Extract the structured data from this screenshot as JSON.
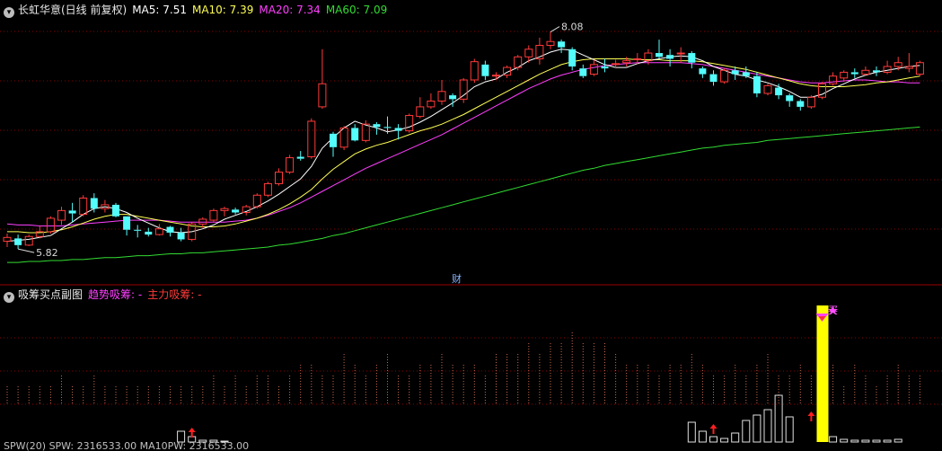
{
  "header": {
    "title": "长虹华意(日线 前复权)",
    "ma5": "MA5: 7.51",
    "ma10": "MA10: 7.39",
    "ma20": "MA20: 7.34",
    "ma60": "MA60: 7.09"
  },
  "sub_header": {
    "title": "吸筹买点副图",
    "trend_label": "趋势吸筹: -",
    "main_label": "主力吸筹: -"
  },
  "bottom_text": "SPW(20) SPW: 2316533.00  MA10PW: 2316533.00",
  "colors": {
    "up": "#ff3a3a",
    "down": "#54fcfc",
    "ma5": "#ffffff",
    "ma10": "#ffff55",
    "ma20": "#ff3fff",
    "ma60": "#32dc32",
    "grid": "#8a0000",
    "highlight": "#ffff00"
  },
  "chart_data": [
    {
      "type": "candlestick",
      "name": "长虹华意(日线 前复权)",
      "annotations": {
        "high": "8.08",
        "low": "5.82",
        "finance_marker": "财"
      },
      "ohlc": [
        [
          5.9,
          5.98,
          5.84,
          5.94
        ],
        [
          5.93,
          5.97,
          5.82,
          5.86
        ],
        [
          5.86,
          5.97,
          5.85,
          5.95
        ],
        [
          5.95,
          6.06,
          5.93,
          6.0
        ],
        [
          6.0,
          6.16,
          5.98,
          6.14
        ],
        [
          6.12,
          6.26,
          6.07,
          6.22
        ],
        [
          6.22,
          6.3,
          6.1,
          6.19
        ],
        [
          6.18,
          6.38,
          6.16,
          6.35
        ],
        [
          6.35,
          6.4,
          6.2,
          6.24
        ],
        [
          6.24,
          6.33,
          6.2,
          6.28
        ],
        [
          6.28,
          6.3,
          6.15,
          6.16
        ],
        [
          6.16,
          6.16,
          5.96,
          6.02
        ],
        [
          6.02,
          6.07,
          5.94,
          6.01
        ],
        [
          6.0,
          6.04,
          5.95,
          5.97
        ],
        [
          5.97,
          6.08,
          5.96,
          6.03
        ],
        [
          6.05,
          6.06,
          5.95,
          5.99
        ],
        [
          5.99,
          6.04,
          5.9,
          5.92
        ],
        [
          5.92,
          6.1,
          5.9,
          6.08
        ],
        [
          6.08,
          6.15,
          6.04,
          6.13
        ],
        [
          6.12,
          6.24,
          6.1,
          6.22
        ],
        [
          6.22,
          6.26,
          6.16,
          6.24
        ],
        [
          6.23,
          6.25,
          6.18,
          6.2
        ],
        [
          6.2,
          6.28,
          6.17,
          6.26
        ],
        [
          6.26,
          6.4,
          6.24,
          6.38
        ],
        [
          6.38,
          6.52,
          6.36,
          6.5
        ],
        [
          6.5,
          6.66,
          6.48,
          6.62
        ],
        [
          6.62,
          6.8,
          6.6,
          6.77
        ],
        [
          6.78,
          6.84,
          6.74,
          6.76
        ],
        [
          6.78,
          7.18,
          6.76,
          7.15
        ],
        [
          7.3,
          7.9,
          7.28,
          7.54
        ],
        [
          7.02,
          7.04,
          6.78,
          6.88
        ],
        [
          6.88,
          7.1,
          6.85,
          7.08
        ],
        [
          7.08,
          7.12,
          6.94,
          6.95
        ],
        [
          6.95,
          7.16,
          6.93,
          7.12
        ],
        [
          7.12,
          7.14,
          7.01,
          7.09
        ],
        [
          7.09,
          7.2,
          7.02,
          7.08
        ],
        [
          7.08,
          7.12,
          6.96,
          7.05
        ],
        [
          7.05,
          7.23,
          7.03,
          7.21
        ],
        [
          7.2,
          7.4,
          7.18,
          7.3
        ],
        [
          7.3,
          7.44,
          7.28,
          7.36
        ],
        [
          7.36,
          7.58,
          7.32,
          7.46
        ],
        [
          7.42,
          7.44,
          7.3,
          7.38
        ],
        [
          7.38,
          7.6,
          7.34,
          7.58
        ],
        [
          7.58,
          7.8,
          7.55,
          7.77
        ],
        [
          7.74,
          7.78,
          7.58,
          7.62
        ],
        [
          7.62,
          7.66,
          7.58,
          7.63
        ],
        [
          7.63,
          7.73,
          7.6,
          7.71
        ],
        [
          7.71,
          7.84,
          7.68,
          7.82
        ],
        [
          7.82,
          7.94,
          7.76,
          7.9
        ],
        [
          7.8,
          8.02,
          7.74,
          7.94
        ],
        [
          7.94,
          8.08,
          7.9,
          7.98
        ],
        [
          7.98,
          8.0,
          7.86,
          7.92
        ],
        [
          7.9,
          7.92,
          7.68,
          7.72
        ],
        [
          7.7,
          7.74,
          7.6,
          7.62
        ],
        [
          7.64,
          7.79,
          7.62,
          7.74
        ],
        [
          7.72,
          7.8,
          7.66,
          7.7
        ],
        [
          7.74,
          7.79,
          7.7,
          7.75
        ],
        [
          7.76,
          7.82,
          7.72,
          7.78
        ],
        [
          7.8,
          7.86,
          7.74,
          7.8
        ],
        [
          7.78,
          7.9,
          7.74,
          7.86
        ],
        [
          7.86,
          8.0,
          7.8,
          7.82
        ],
        [
          7.84,
          7.9,
          7.72,
          7.8
        ],
        [
          7.86,
          7.92,
          7.76,
          7.86
        ],
        [
          7.86,
          7.88,
          7.7,
          7.76
        ],
        [
          7.7,
          7.72,
          7.6,
          7.64
        ],
        [
          7.64,
          7.68,
          7.52,
          7.56
        ],
        [
          7.56,
          7.7,
          7.54,
          7.68
        ],
        [
          7.68,
          7.72,
          7.58,
          7.64
        ],
        [
          7.66,
          7.72,
          7.6,
          7.62
        ],
        [
          7.62,
          7.66,
          7.4,
          7.44
        ],
        [
          7.44,
          7.54,
          7.42,
          7.52
        ],
        [
          7.5,
          7.54,
          7.38,
          7.42
        ],
        [
          7.42,
          7.44,
          7.3,
          7.36
        ],
        [
          7.36,
          7.38,
          7.26,
          7.3
        ],
        [
          7.3,
          7.42,
          7.28,
          7.4
        ],
        [
          7.4,
          7.56,
          7.38,
          7.54
        ],
        [
          7.54,
          7.66,
          7.52,
          7.62
        ],
        [
          7.6,
          7.68,
          7.56,
          7.66
        ],
        [
          7.66,
          7.7,
          7.6,
          7.64
        ],
        [
          7.64,
          7.72,
          7.62,
          7.68
        ],
        [
          7.68,
          7.72,
          7.62,
          7.66
        ],
        [
          7.66,
          7.78,
          7.64,
          7.72
        ],
        [
          7.72,
          7.82,
          7.68,
          7.76
        ],
        [
          7.7,
          7.86,
          7.66,
          7.72
        ],
        [
          7.64,
          7.78,
          7.62,
          7.76
        ]
      ],
      "ma5": [
        5.9,
        5.91,
        5.92,
        5.94,
        5.96,
        6.03,
        6.1,
        6.18,
        6.24,
        6.26,
        6.24,
        6.2,
        6.14,
        6.09,
        6.04,
        6.0,
        5.99,
        6.0,
        6.03,
        6.07,
        6.13,
        6.17,
        6.21,
        6.26,
        6.32,
        6.39,
        6.47,
        6.55,
        6.68,
        6.87,
        6.98,
        7.08,
        7.15,
        7.11,
        7.08,
        7.04,
        7.06,
        7.09,
        7.14,
        7.2,
        7.27,
        7.34,
        7.42,
        7.51,
        7.56,
        7.59,
        7.66,
        7.71,
        7.78,
        7.82,
        7.87,
        7.9,
        7.89,
        7.84,
        7.79,
        7.74,
        7.71,
        7.71,
        7.75,
        7.78,
        7.8,
        7.82,
        7.83,
        7.82,
        7.78,
        7.72,
        7.68,
        7.64,
        7.62,
        7.58,
        7.55,
        7.51,
        7.46,
        7.4,
        7.4,
        7.43,
        7.49,
        7.54,
        7.59,
        7.63,
        7.66,
        7.68,
        7.7,
        7.72,
        7.73
      ],
      "ma10": [
        6.0,
        6.0,
        5.99,
        5.99,
        6.0,
        6.02,
        6.05,
        6.09,
        6.13,
        6.16,
        6.18,
        6.18,
        6.16,
        6.14,
        6.12,
        6.1,
        6.08,
        6.06,
        6.05,
        6.05,
        6.06,
        6.08,
        6.11,
        6.14,
        6.18,
        6.23,
        6.29,
        6.36,
        6.44,
        6.55,
        6.65,
        6.73,
        6.81,
        6.86,
        6.9,
        6.93,
        6.97,
        7.01,
        7.05,
        7.08,
        7.12,
        7.17,
        7.22,
        7.28,
        7.34,
        7.4,
        7.46,
        7.52,
        7.58,
        7.64,
        7.69,
        7.74,
        7.77,
        7.79,
        7.8,
        7.8,
        7.8,
        7.8,
        7.79,
        7.79,
        7.79,
        7.78,
        7.78,
        7.78,
        7.77,
        7.75,
        7.73,
        7.71,
        7.69,
        7.66,
        7.63,
        7.6,
        7.57,
        7.54,
        7.52,
        7.51,
        7.51,
        7.51,
        7.52,
        7.53,
        7.55,
        7.56,
        7.58,
        7.6,
        7.62
      ],
      "ma20": [
        6.08,
        6.07,
        6.07,
        6.06,
        6.06,
        6.06,
        6.07,
        6.08,
        6.09,
        6.1,
        6.11,
        6.12,
        6.12,
        6.12,
        6.12,
        6.11,
        6.1,
        6.1,
        6.1,
        6.1,
        6.1,
        6.11,
        6.12,
        6.14,
        6.17,
        6.21,
        6.25,
        6.3,
        6.36,
        6.42,
        6.48,
        6.54,
        6.6,
        6.66,
        6.71,
        6.76,
        6.81,
        6.86,
        6.91,
        6.96,
        7.01,
        7.07,
        7.13,
        7.19,
        7.25,
        7.31,
        7.37,
        7.43,
        7.49,
        7.54,
        7.59,
        7.63,
        7.66,
        7.69,
        7.71,
        7.73,
        7.74,
        7.75,
        7.76,
        7.76,
        7.76,
        7.76,
        7.76,
        7.75,
        7.74,
        7.72,
        7.7,
        7.68,
        7.66,
        7.64,
        7.62,
        7.6,
        7.58,
        7.56,
        7.55,
        7.55,
        7.56,
        7.57,
        7.58,
        7.58,
        7.57,
        7.56,
        7.56,
        7.55,
        7.55
      ],
      "ma60": [
        5.68,
        5.68,
        5.69,
        5.69,
        5.7,
        5.7,
        5.71,
        5.71,
        5.72,
        5.73,
        5.73,
        5.74,
        5.75,
        5.75,
        5.76,
        5.77,
        5.77,
        5.78,
        5.78,
        5.79,
        5.8,
        5.81,
        5.82,
        5.83,
        5.84,
        5.86,
        5.87,
        5.89,
        5.91,
        5.93,
        5.96,
        5.98,
        6.01,
        6.04,
        6.07,
        6.1,
        6.13,
        6.16,
        6.19,
        6.22,
        6.25,
        6.28,
        6.31,
        6.34,
        6.37,
        6.4,
        6.43,
        6.46,
        6.49,
        6.52,
        6.55,
        6.58,
        6.61,
        6.64,
        6.66,
        6.69,
        6.71,
        6.73,
        6.75,
        6.77,
        6.79,
        6.81,
        6.83,
        6.85,
        6.87,
        6.88,
        6.9,
        6.91,
        6.92,
        6.93,
        6.95,
        6.96,
        6.97,
        6.98,
        6.99,
        7.0,
        7.01,
        7.02,
        7.03,
        7.04,
        7.05,
        7.06,
        7.07,
        7.08,
        7.09
      ]
    },
    {
      "type": "bar",
      "name": "吸筹买点副图",
      "signal_label": "买",
      "values": [
        0,
        0,
        0,
        0,
        0,
        0,
        0,
        0,
        0,
        0,
        0,
        0,
        0,
        0,
        0,
        0,
        0,
        0,
        0,
        0,
        0,
        0,
        0,
        0,
        0,
        0,
        0,
        0,
        0,
        0,
        0,
        0,
        0,
        0,
        0,
        0,
        0,
        0,
        0,
        0,
        0,
        0,
        0,
        0,
        0,
        0,
        0,
        0,
        0,
        0,
        0,
        0,
        0,
        0,
        0,
        0,
        0,
        0,
        0,
        0,
        0,
        0,
        0,
        0,
        0,
        0,
        0,
        0,
        0,
        0,
        0,
        0,
        0,
        0,
        0,
        0,
        0,
        0,
        0,
        0,
        0,
        0,
        0,
        0,
        0
      ],
      "ref_lines": [
        1,
        1,
        1,
        1,
        1,
        2,
        1,
        1,
        2,
        1,
        1,
        1,
        1,
        1,
        1,
        1,
        1,
        1,
        1,
        2,
        1,
        2,
        1,
        2,
        2,
        1,
        2,
        3,
        3,
        2,
        2,
        4,
        3,
        2,
        3,
        4,
        2,
        2,
        3,
        3,
        4,
        3,
        3,
        3,
        2,
        4,
        4,
        4,
        5,
        4,
        5,
        5,
        6,
        5,
        5,
        5,
        4,
        3,
        3,
        3,
        2,
        3,
        3,
        4,
        3,
        2,
        2,
        3,
        2,
        3,
        4,
        2,
        2,
        3,
        2,
        2,
        3,
        1,
        3,
        2,
        1,
        2,
        3,
        2,
        2
      ],
      "small_bars": [
        0,
        0,
        0,
        0,
        0,
        0,
        0,
        0,
        0,
        0,
        0,
        0,
        0,
        0,
        0,
        0,
        0,
        0,
        0,
        0,
        0,
        0,
        0,
        0,
        0,
        0,
        0,
        0,
        0,
        0,
        0,
        0,
        0,
        0,
        0,
        0,
        0,
        0,
        0,
        0,
        0,
        0,
        0,
        0,
        0,
        0,
        0,
        0,
        0,
        0,
        0,
        0,
        0,
        0,
        0,
        0,
        0,
        0,
        0,
        0,
        0,
        0,
        0,
        0,
        0,
        0,
        0,
        0,
        0,
        0,
        0,
        0,
        0,
        0,
        0,
        0,
        0,
        0,
        0,
        0,
        0,
        0,
        0,
        0,
        0
      ]
    }
  ]
}
